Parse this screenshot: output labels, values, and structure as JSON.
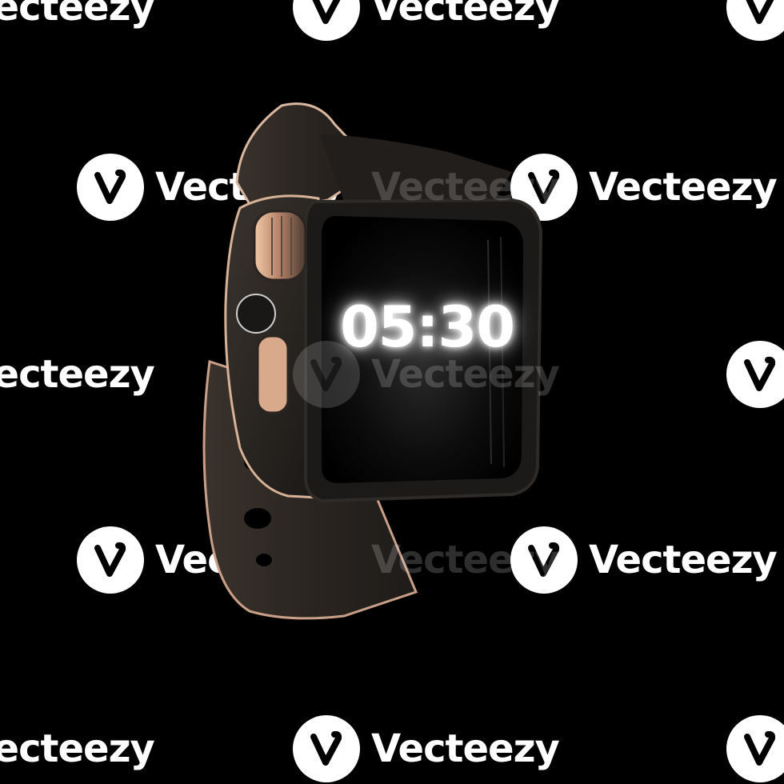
{
  "watch": {
    "time": "05:30",
    "band_color": "#2b2622",
    "case_color": "#24211f",
    "accent_color": "#e2b79a",
    "screen_color": "#050505"
  },
  "watermark": {
    "text": "Vecteezy",
    "logo_icon": "vecteezy-v-logo-icon"
  }
}
